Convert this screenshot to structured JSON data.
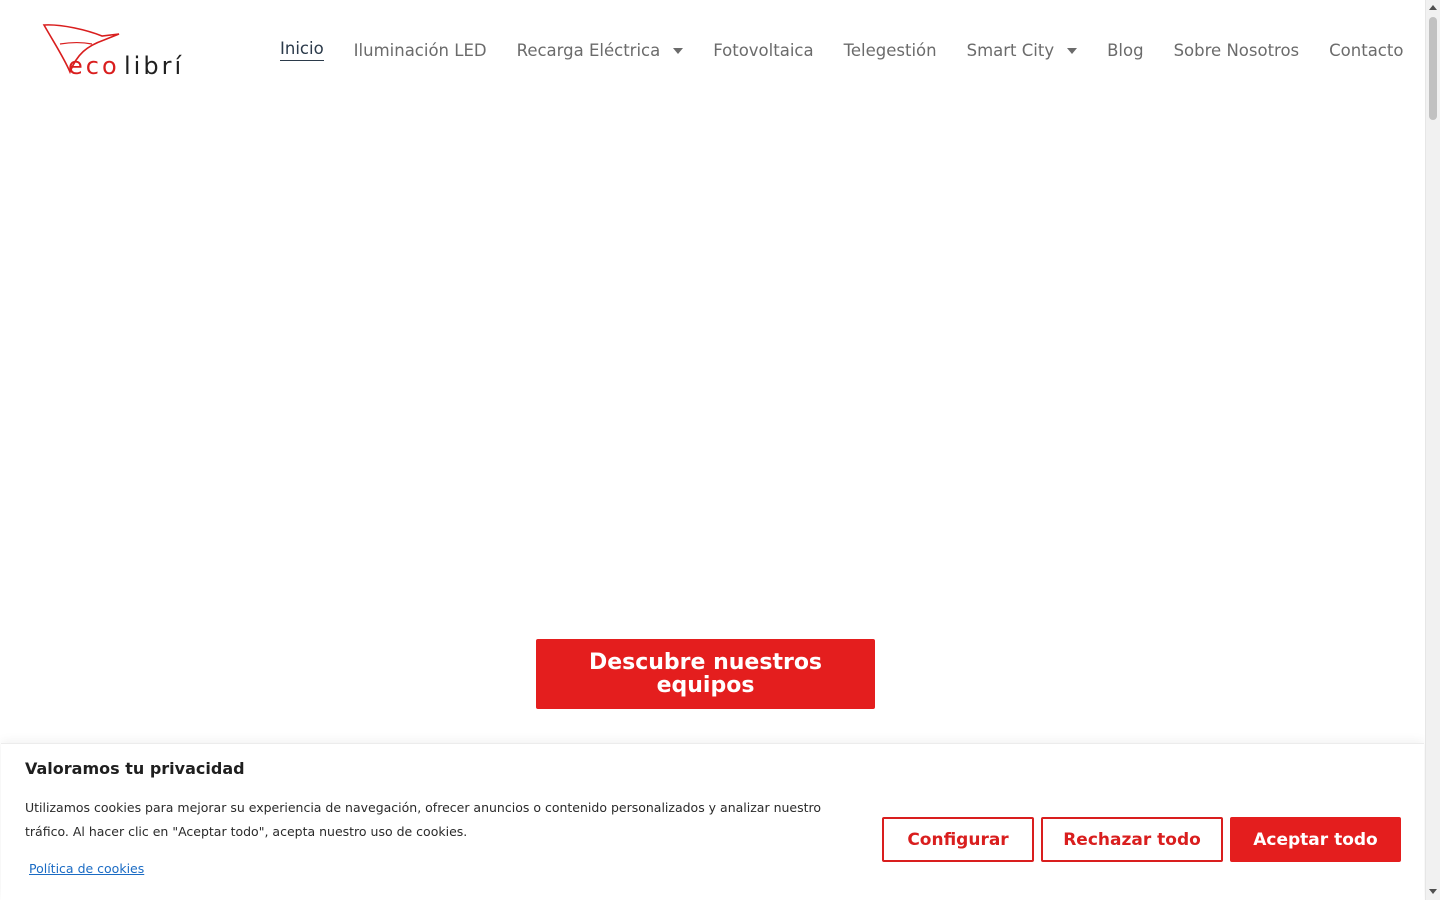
{
  "header": {
    "logo_text": "ecolibrí",
    "nav": [
      {
        "label": "Inicio",
        "active": true,
        "has_dropdown": false
      },
      {
        "label": "Iluminación LED",
        "active": false,
        "has_dropdown": false
      },
      {
        "label": "Recarga Eléctrica",
        "active": false,
        "has_dropdown": true
      },
      {
        "label": "Fotovoltaica",
        "active": false,
        "has_dropdown": false
      },
      {
        "label": "Telegestión",
        "active": false,
        "has_dropdown": false
      },
      {
        "label": "Smart City",
        "active": false,
        "has_dropdown": true
      },
      {
        "label": "Blog",
        "active": false,
        "has_dropdown": false
      },
      {
        "label": "Sobre Nosotros",
        "active": false,
        "has_dropdown": false
      },
      {
        "label": "Contacto",
        "active": false,
        "has_dropdown": false
      }
    ]
  },
  "hero": {
    "cta_label": "Descubre nuestros equipos"
  },
  "cookie_banner": {
    "title": "Valoramos tu privacidad",
    "text": "Utilizamos cookies para mejorar su experiencia de navegación, ofrecer anuncios o contenido personalizados y analizar nuestro tráfico. Al hacer clic en \"Aceptar todo\", acepta nuestro uso de cookies.",
    "policy_link": "Política de cookies",
    "configure_label": "Configurar",
    "reject_label": "Rechazar todo",
    "accept_label": "Aceptar todo"
  },
  "colors": {
    "brand_red": "#e41e1e",
    "nav_text": "#6b6b6b",
    "nav_active": "#2b3a4a",
    "link_blue": "#1a6bc4"
  }
}
